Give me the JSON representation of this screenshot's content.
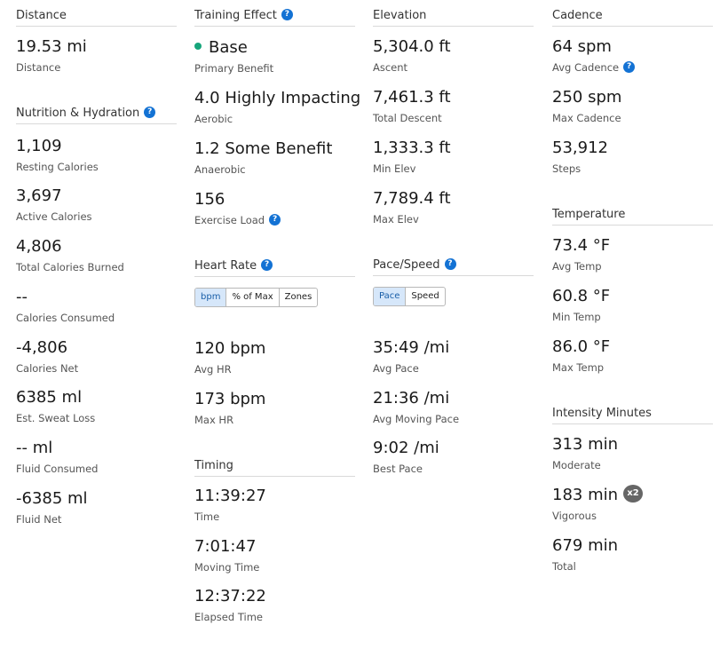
{
  "distance": {
    "title": "Distance",
    "stats": [
      {
        "value": "19.53 mi",
        "label": "Distance"
      }
    ]
  },
  "nutrition": {
    "title": "Nutrition & Hydration",
    "help": "?",
    "stats": [
      {
        "value": "1,109",
        "label": "Resting Calories"
      },
      {
        "value": "3,697",
        "label": "Active Calories"
      },
      {
        "value": "4,806",
        "label": "Total Calories Burned"
      },
      {
        "value": "--",
        "label": "Calories Consumed"
      },
      {
        "value": "-4,806",
        "label": "Calories Net"
      },
      {
        "value": "6385 ml",
        "label": "Est. Sweat Loss"
      },
      {
        "value": "-- ml",
        "label": "Fluid Consumed"
      },
      {
        "value": "-6385 ml",
        "label": "Fluid Net"
      }
    ]
  },
  "training_effect": {
    "title": "Training Effect",
    "help": "?",
    "dot_color": "#16a57b",
    "stats": [
      {
        "value": "Base",
        "label": "Primary Benefit"
      },
      {
        "value": "4.0 Highly Impacting",
        "label": "Aerobic"
      },
      {
        "value": "1.2 Some Benefit",
        "label": "Anaerobic"
      },
      {
        "value": "156",
        "label": "Exercise Load",
        "help": "?"
      }
    ]
  },
  "heart_rate": {
    "title": "Heart Rate",
    "help": "?",
    "toggle": [
      "bpm",
      "% of Max",
      "Zones"
    ],
    "active": "bpm",
    "stats": [
      {
        "value": "120 bpm",
        "label": "Avg HR"
      },
      {
        "value": "173 bpm",
        "label": "Max HR"
      }
    ]
  },
  "timing": {
    "title": "Timing",
    "stats": [
      {
        "value": "11:39:27",
        "label": "Time"
      },
      {
        "value": "7:01:47",
        "label": "Moving Time"
      },
      {
        "value": "12:37:22",
        "label": "Elapsed Time"
      }
    ]
  },
  "elevation": {
    "title": "Elevation",
    "stats": [
      {
        "value": "5,304.0 ft",
        "label": "Ascent"
      },
      {
        "value": "7,461.3 ft",
        "label": "Total Descent"
      },
      {
        "value": "1,333.3 ft",
        "label": "Min Elev"
      },
      {
        "value": "7,789.4 ft",
        "label": "Max Elev"
      }
    ]
  },
  "pace": {
    "title": "Pace/Speed",
    "help": "?",
    "toggle": [
      "Pace",
      "Speed"
    ],
    "active": "Pace",
    "stats": [
      {
        "value": "35:49 /mi",
        "label": "Avg Pace"
      },
      {
        "value": "21:36 /mi",
        "label": "Avg Moving Pace"
      },
      {
        "value": "9:02 /mi",
        "label": "Best Pace"
      }
    ]
  },
  "cadence": {
    "title": "Cadence",
    "stats": [
      {
        "value": "64 spm",
        "label": "Avg Cadence",
        "help": "?"
      },
      {
        "value": "250 spm",
        "label": "Max Cadence"
      },
      {
        "value": "53,912",
        "label": "Steps"
      }
    ]
  },
  "temperature": {
    "title": "Temperature",
    "stats": [
      {
        "value": "73.4 °F",
        "label": "Avg Temp"
      },
      {
        "value": "60.8 °F",
        "label": "Min Temp"
      },
      {
        "value": "86.0 °F",
        "label": "Max Temp"
      }
    ]
  },
  "intensity": {
    "title": "Intensity Minutes",
    "stats": [
      {
        "value": "313 min",
        "label": "Moderate"
      },
      {
        "value": "183 min",
        "label": "Vigorous",
        "badge": "x2"
      },
      {
        "value": "679 min",
        "label": "Total"
      }
    ]
  },
  "colors": {
    "accent": "#1372d4",
    "toggle_active_bg": "#d6e7fa",
    "divider": "#d9d9d9"
  }
}
